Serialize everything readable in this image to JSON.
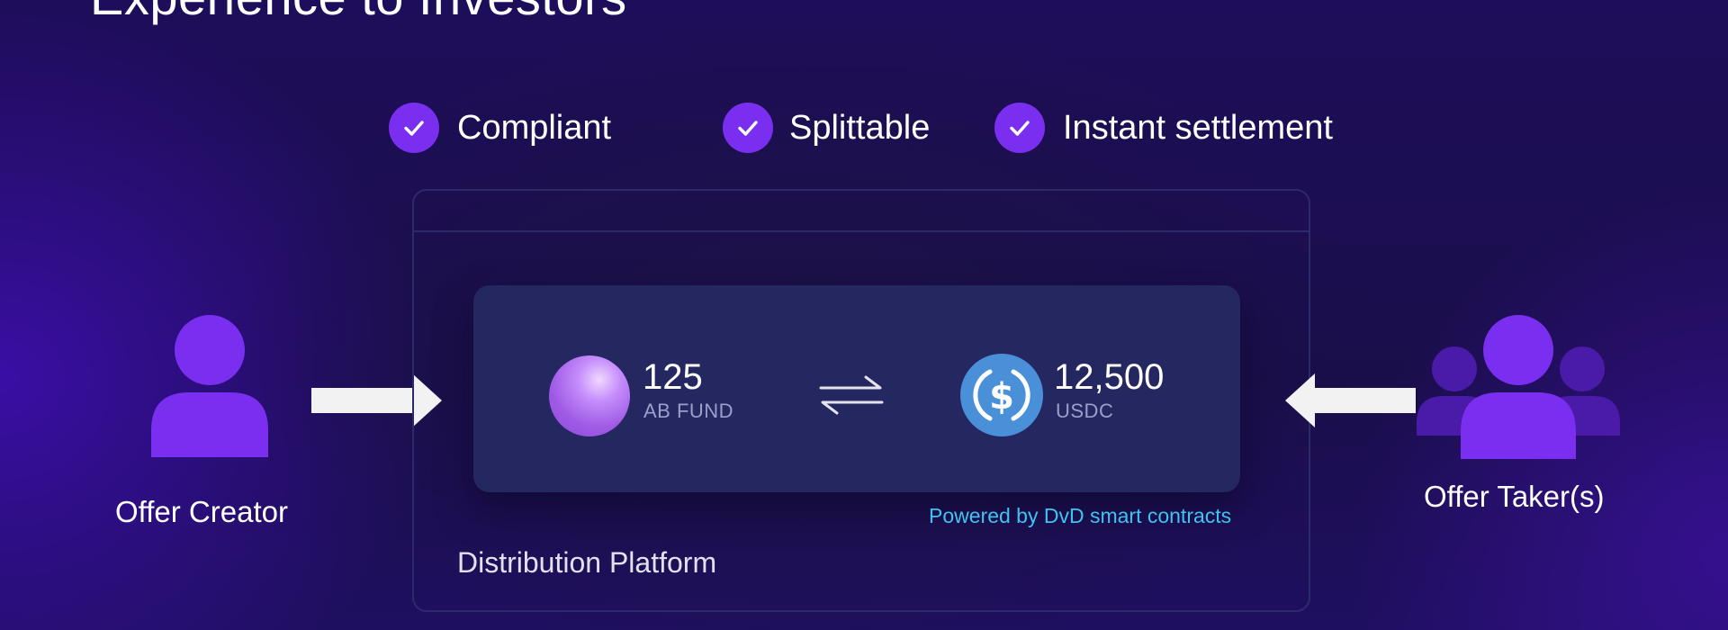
{
  "page": {
    "title": "Experience to Investors"
  },
  "features": [
    {
      "label": "Compliant"
    },
    {
      "label": "Splittable"
    },
    {
      "label": "Instant settlement"
    }
  ],
  "offer_creator": {
    "label": "Offer Creator"
  },
  "offer_taker": {
    "label": "Offer Taker(s)"
  },
  "platform": {
    "label": "Distribution Platform",
    "powered_by": "Powered by DvD smart contracts"
  },
  "swap": {
    "give": {
      "amount": "125",
      "unit": "AB FUND",
      "icon": "fund-orb-icon"
    },
    "get": {
      "amount": "12,500",
      "unit": "USDC",
      "icon": "usdc-coin-icon"
    },
    "swap_icon": "swap-arrows-icon"
  },
  "colors": {
    "accent_purple": "#7a2ff0",
    "card_navy": "#252761",
    "powered_by_cyan": "#3fc3f0",
    "usdc_blue": "#4a90d8"
  }
}
